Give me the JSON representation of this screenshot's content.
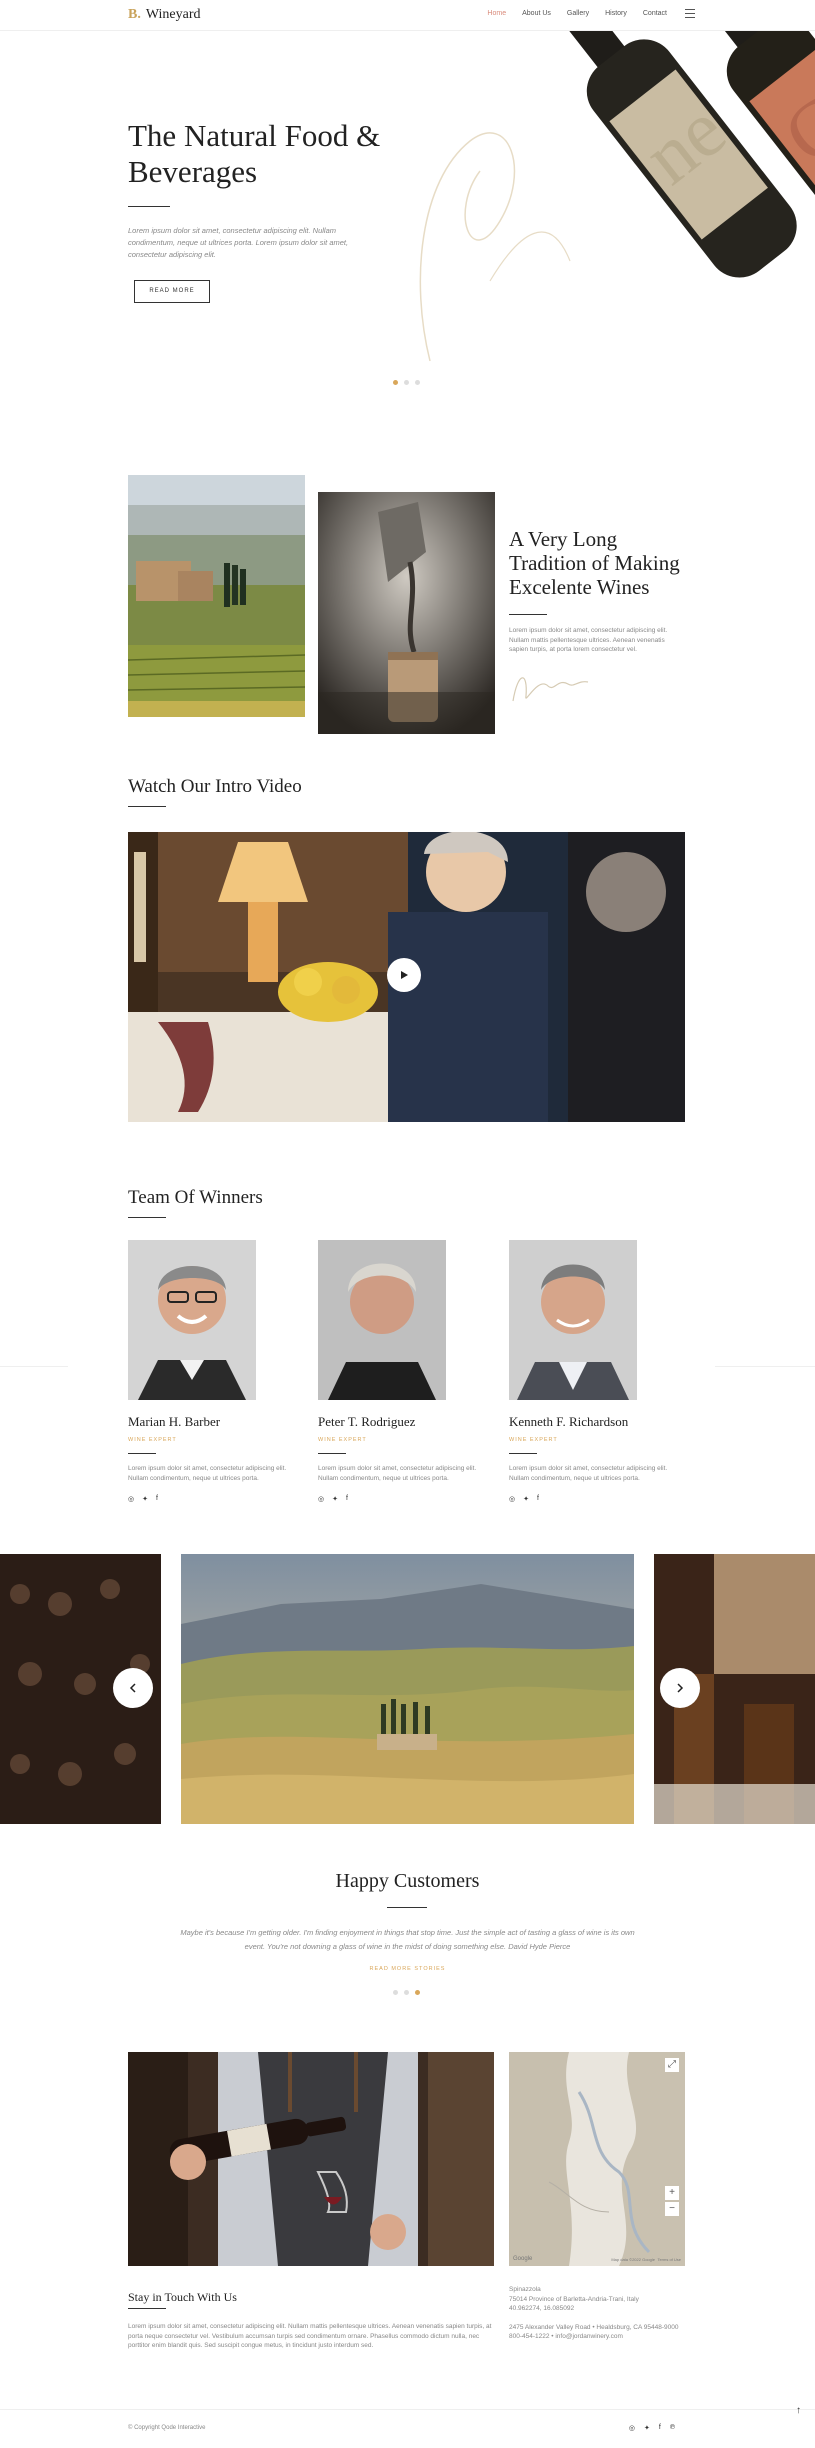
{
  "header": {
    "logo_mark": "B.",
    "logo_text": "Wineyard",
    "nav": [
      {
        "label": "Home",
        "active": true
      },
      {
        "label": "About Us",
        "active": false
      },
      {
        "label": "Gallery",
        "active": false
      },
      {
        "label": "History",
        "active": false
      },
      {
        "label": "Contact",
        "active": false
      }
    ],
    "menu_icon": "hamburger-icon"
  },
  "hero": {
    "title": "The Natural Food & Beverages",
    "text": "Lorem ipsum dolor sit amet, consectetur adipiscing elit. Nullam condimentum, neque ut ultrices porta. Lorem ipsum dolor sit amet, consectetur adipiscing elit.",
    "button_label": "READ MORE",
    "slides": 3,
    "active_slide": 1
  },
  "tradition": {
    "title": "A Very Long Tradition of Making Excelente Wines",
    "text": "Lorem ipsum dolor sit amet, consectetur adipiscing elit. Nullam mattis pellentesque ultrices. Aenean venenatis sapien turpis, at porta lorem consectetur vel."
  },
  "video": {
    "title": "Watch Our Intro Video",
    "play_icon": "play-icon"
  },
  "team": {
    "title": "Team Of Winners",
    "members": [
      {
        "name": "Marian H. Barber",
        "role": "WINE EXPERT",
        "text": "Lorem ipsum dolor sit amet, consectetur adipiscing elit. Nullam condimentum, neque ut ultrices porta."
      },
      {
        "name": "Peter T. Rodriguez",
        "role": "WINE EXPERT",
        "text": "Lorem ipsum dolor sit amet, consectetur adipiscing elit. Nullam condimentum, neque ut ultrices porta."
      },
      {
        "name": "Kenneth F. Richardson",
        "role": "WINE EXPERT",
        "text": "Lorem ipsum dolor sit amet, consectetur adipiscing elit. Nullam condimentum, neque ut ultrices porta."
      }
    ],
    "social_icons": [
      "instagram-icon",
      "twitter-icon",
      "facebook-icon"
    ]
  },
  "carousel": {
    "prev_icon": "chevron-left-icon",
    "next_icon": "chevron-right-icon"
  },
  "testimonials": {
    "title": "Happy Customers",
    "quote": "Maybe it's because I'm getting older. I'm finding enjoyment in things that stop time. Just the simple act of tasting a glass of wine is its own event. You're not downing a glass of wine in the midst of doing something else. David Hyde Pierce",
    "link": "READ MORE STORIES",
    "slides": 3,
    "active_slide": 3
  },
  "contact": {
    "title": "Stay in Touch With Us",
    "text": "Lorem ipsum dolor sit amet, consectetur adipiscing elit. Nullam mattis pellentesque ultrices. Aenean venenatis sapien turpis, at porta neque consectetur vel. Vestibulum accumsan turpis sed condimentum ornare. Phasellus commodo dictum nulla, nec porttitor enim blandit quis. Sed suscipit congue metus, in tincidunt justo interdum sed.",
    "address_lines": [
      "Spinazzola",
      "75014 Province of Barletta-Andria-Trani, Italy",
      "40.962274, 16.085092"
    ],
    "contact_lines": [
      "2475 Alexander Valley Road • Healdsburg, CA 95448-9000",
      "800-454-1222 • info@jordanwinery.com"
    ],
    "map_labels": [
      "Google",
      "Map data ©2022 Google",
      "Terms of Use"
    ]
  },
  "footer": {
    "copyright": "© Copyright Qode Interactive",
    "social_icons": [
      "instagram-icon",
      "twitter-icon",
      "facebook-icon",
      "pinterest-icon"
    ],
    "back_to_top": "↑"
  }
}
